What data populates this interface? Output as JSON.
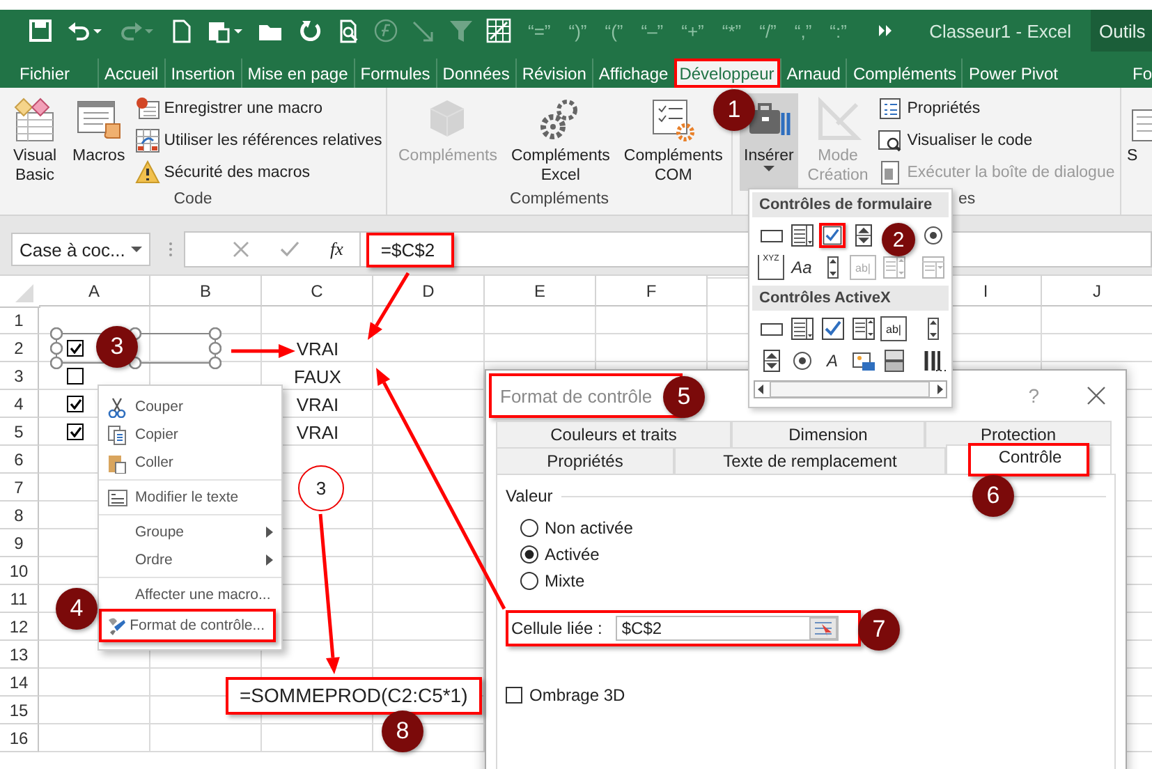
{
  "title_bar": {
    "quick_access": [
      {
        "kind": "save",
        "disabled": false
      },
      {
        "kind": "undo",
        "disabled": false
      },
      {
        "kind": "redo",
        "disabled": true
      },
      {
        "kind": "new",
        "disabled": false
      },
      {
        "kind": "paste",
        "disabled": false
      },
      {
        "kind": "open",
        "disabled": false
      },
      {
        "kind": "refresh",
        "disabled": false
      },
      {
        "kind": "preview",
        "disabled": false
      },
      {
        "kind": "function",
        "disabled": true
      },
      {
        "kind": "arrow",
        "disabled": true
      },
      {
        "kind": "filter",
        "disabled": true
      },
      {
        "kind": "table",
        "disabled": false
      }
    ],
    "symbol_buttons": [
      "“=”",
      "“)”",
      "“(”",
      "“–”",
      "“+”",
      "“*”",
      "“/”",
      "“,”",
      "“:”"
    ],
    "title": "Classeur1 - Excel",
    "context_label": "Outils"
  },
  "ribbon": {
    "tabs": [
      {
        "label": "Fichier",
        "selected": false,
        "highlighted": false
      },
      {
        "label": "Accueil",
        "selected": false,
        "highlighted": false
      },
      {
        "label": "Insertion",
        "selected": false,
        "highlighted": false
      },
      {
        "label": "Mise en page",
        "selected": false,
        "highlighted": false
      },
      {
        "label": "Formules",
        "selected": false,
        "highlighted": false
      },
      {
        "label": "Données",
        "selected": false,
        "highlighted": false
      },
      {
        "label": "Révision",
        "selected": false,
        "highlighted": false
      },
      {
        "label": "Affichage",
        "selected": false,
        "highlighted": false
      },
      {
        "label": "Développeur",
        "selected": true,
        "highlighted": true
      },
      {
        "label": "Arnaud",
        "selected": false,
        "highlighted": false
      },
      {
        "label": "Compléments",
        "selected": false,
        "highlighted": false
      },
      {
        "label": "Power Pivot",
        "selected": false,
        "highlighted": false
      },
      {
        "label": "Fo",
        "selected": false,
        "highlighted": false
      }
    ],
    "groups": [
      {
        "label": "Code",
        "items": [
          {
            "kind": "visual_basic",
            "label": "Visual Basic",
            "disabled": false
          },
          {
            "kind": "macros",
            "label": "Macros",
            "disabled": false
          },
          {
            "kind": "record",
            "label": "Enregistrer une macro",
            "disabled": false
          },
          {
            "kind": "relative",
            "label": "Utiliser les références relatives",
            "disabled": false
          },
          {
            "kind": "security",
            "label": "Sécurité des macros",
            "disabled": false
          }
        ]
      },
      {
        "label": "Compléments",
        "items": [
          {
            "kind": "addins",
            "label": "Compléments",
            "disabled": true
          },
          {
            "kind": "addins_excel",
            "label": "Compléments Excel",
            "disabled": false
          },
          {
            "kind": "addins_com",
            "label": "Compléments COM",
            "disabled": false
          }
        ]
      },
      {
        "label": "es",
        "items": [
          {
            "kind": "insert",
            "label": "Insérer",
            "disabled": false,
            "pressed": true,
            "dropdown": true
          },
          {
            "kind": "design",
            "label": "Mode Création",
            "disabled": true
          },
          {
            "kind": "properties",
            "label": "Propriétés",
            "disabled": false
          },
          {
            "kind": "view_code",
            "label": "Visualiser le code",
            "disabled": false
          },
          {
            "kind": "run_dialog",
            "label": "Exécuter la boîte de dialogue",
            "disabled": true
          }
        ]
      },
      {
        "items": [
          {
            "kind": "source",
            "label": "S",
            "disabled": false
          }
        ]
      }
    ]
  },
  "formula_bar": {
    "name_box": "Case à coc...",
    "function_label": "fx",
    "formula": "=$C$2",
    "highlighted": true
  },
  "sheet": {
    "columns": [
      "A",
      "B",
      "C",
      "D",
      "E",
      "F",
      null,
      null,
      "I",
      "J"
    ],
    "rows": [
      {
        "header": "1"
      },
      {
        "header": "2",
        "checkbox": {
          "checked": true,
          "selected": true
        },
        "cells": {
          "C": "VRAI"
        }
      },
      {
        "header": "3",
        "checkbox": {
          "checked": false
        },
        "cells": {
          "C": "FAUX"
        }
      },
      {
        "header": "4",
        "checkbox": {
          "checked": true
        },
        "cells": {
          "C": "VRAI"
        }
      },
      {
        "header": "5",
        "checkbox": {
          "checked": true
        },
        "cells": {
          "C": "VRAI"
        }
      },
      {
        "header": "6"
      },
      {
        "header": "7"
      },
      {
        "header": "8"
      },
      {
        "header": "9"
      },
      {
        "header": "10"
      },
      {
        "header": "11"
      },
      {
        "header": "12"
      },
      {
        "header": "13"
      },
      {
        "header": "14"
      },
      {
        "header": "15"
      },
      {
        "header": "16"
      }
    ]
  },
  "context_menu": {
    "sections": [
      [
        {
          "kind": "cut",
          "label": "Couper",
          "submenu": false,
          "highlighted": false
        },
        {
          "kind": "copy",
          "label": "Copier",
          "submenu": false,
          "highlighted": false
        },
        {
          "kind": "paste",
          "label": "Coller",
          "submenu": false,
          "highlighted": false
        }
      ],
      [
        {
          "kind": "edit_text",
          "label": "Modifier le texte",
          "submenu": false,
          "highlighted": false
        }
      ],
      [
        {
          "kind": "plain",
          "label": "Groupe",
          "submenu": true,
          "highlighted": false
        },
        {
          "kind": "plain",
          "label": "Ordre",
          "submenu": true,
          "highlighted": false
        }
      ],
      [
        {
          "kind": "plain",
          "label": "Affecter une macro...",
          "submenu": false,
          "highlighted": false
        },
        {
          "kind": "format",
          "label": "Format de contrôle...",
          "submenu": false,
          "highlighted": true
        }
      ]
    ]
  },
  "controls_menu": {
    "sections": [
      {
        "title": "Contrôles de formulaire",
        "controls": [
          {
            "kind": "button",
            "disabled": false,
            "highlighted": false
          },
          {
            "kind": "combo",
            "disabled": false,
            "highlighted": false
          },
          {
            "kind": "check",
            "disabled": false,
            "highlighted": true
          },
          {
            "kind": "spin",
            "disabled": false,
            "highlighted": false
          },
          {
            "kind": "radio",
            "disabled": false,
            "highlighted": false
          },
          {
            "kind": "group",
            "glyph": "XYZ",
            "disabled": false,
            "highlighted": false
          },
          {
            "kind": "label",
            "glyph": "Aa",
            "disabled": false,
            "highlighted": false
          },
          {
            "kind": "scroll",
            "disabled": false,
            "highlighted": false
          },
          {
            "kind": "textfield",
            "glyph": "ab|",
            "disabled": true,
            "highlighted": false
          },
          {
            "kind": "combolist",
            "disabled": true,
            "highlighted": false
          },
          {
            "kind": "combodrop",
            "disabled": true,
            "highlighted": false
          }
        ]
      },
      {
        "title": "Contrôles ActiveX",
        "controls": [
          {
            "kind": "button",
            "disabled": false,
            "highlighted": false
          },
          {
            "kind": "combo",
            "disabled": false,
            "highlighted": false
          },
          {
            "kind": "check",
            "disabled": false,
            "highlighted": false
          },
          {
            "kind": "listbox",
            "disabled": false,
            "highlighted": false
          },
          {
            "kind": "textfield",
            "glyph": "ab|",
            "disabled": false,
            "highlighted": false
          },
          {
            "kind": "scroll",
            "disabled": false,
            "highlighted": false
          },
          {
            "kind": "spin",
            "disabled": false,
            "highlighted": false
          },
          {
            "kind": "radio",
            "disabled": false,
            "highlighted": false
          },
          {
            "kind": "label",
            "glyph": "A",
            "disabled": false,
            "highlighted": false
          },
          {
            "kind": "image",
            "disabled": false,
            "highlighted": false
          },
          {
            "kind": "toggle",
            "disabled": false,
            "highlighted": false
          },
          {
            "kind": "more",
            "disabled": false,
            "highlighted": false
          }
        ]
      }
    ]
  },
  "dialog": {
    "title": "Format de contrôle",
    "title_highlighted": true,
    "help": "?",
    "tab_rows": [
      [
        {
          "label": "Couleurs et traits",
          "selected": false,
          "highlighted": false
        },
        {
          "label": "Dimension",
          "selected": false,
          "highlighted": false
        },
        {
          "label": "Protection",
          "selected": false,
          "highlighted": false
        }
      ],
      [
        {
          "label": "Propriétés",
          "selected": false,
          "highlighted": false
        },
        {
          "label": "Texte de remplacement",
          "selected": false,
          "highlighted": false
        },
        {
          "label": "Contrôle",
          "selected": true,
          "highlighted": true
        }
      ]
    ],
    "value_group": {
      "label": "Valeur",
      "options": [
        {
          "label": "Non activée",
          "selected": false
        },
        {
          "label": "Activée",
          "selected": true
        },
        {
          "label": "Mixte",
          "selected": false
        }
      ]
    },
    "linked_cell": {
      "label": "Cellule liée :",
      "value": "$C$2",
      "highlighted": true
    },
    "shading": {
      "label": "Ombrage 3D",
      "checked": false
    }
  },
  "annotations": {
    "formula_callout": "=SOMMEPROD(C2:C5*1)",
    "step_circle": "3",
    "markers": [
      "1",
      "2",
      "3",
      "4",
      "5",
      "6",
      "7",
      "8"
    ]
  }
}
